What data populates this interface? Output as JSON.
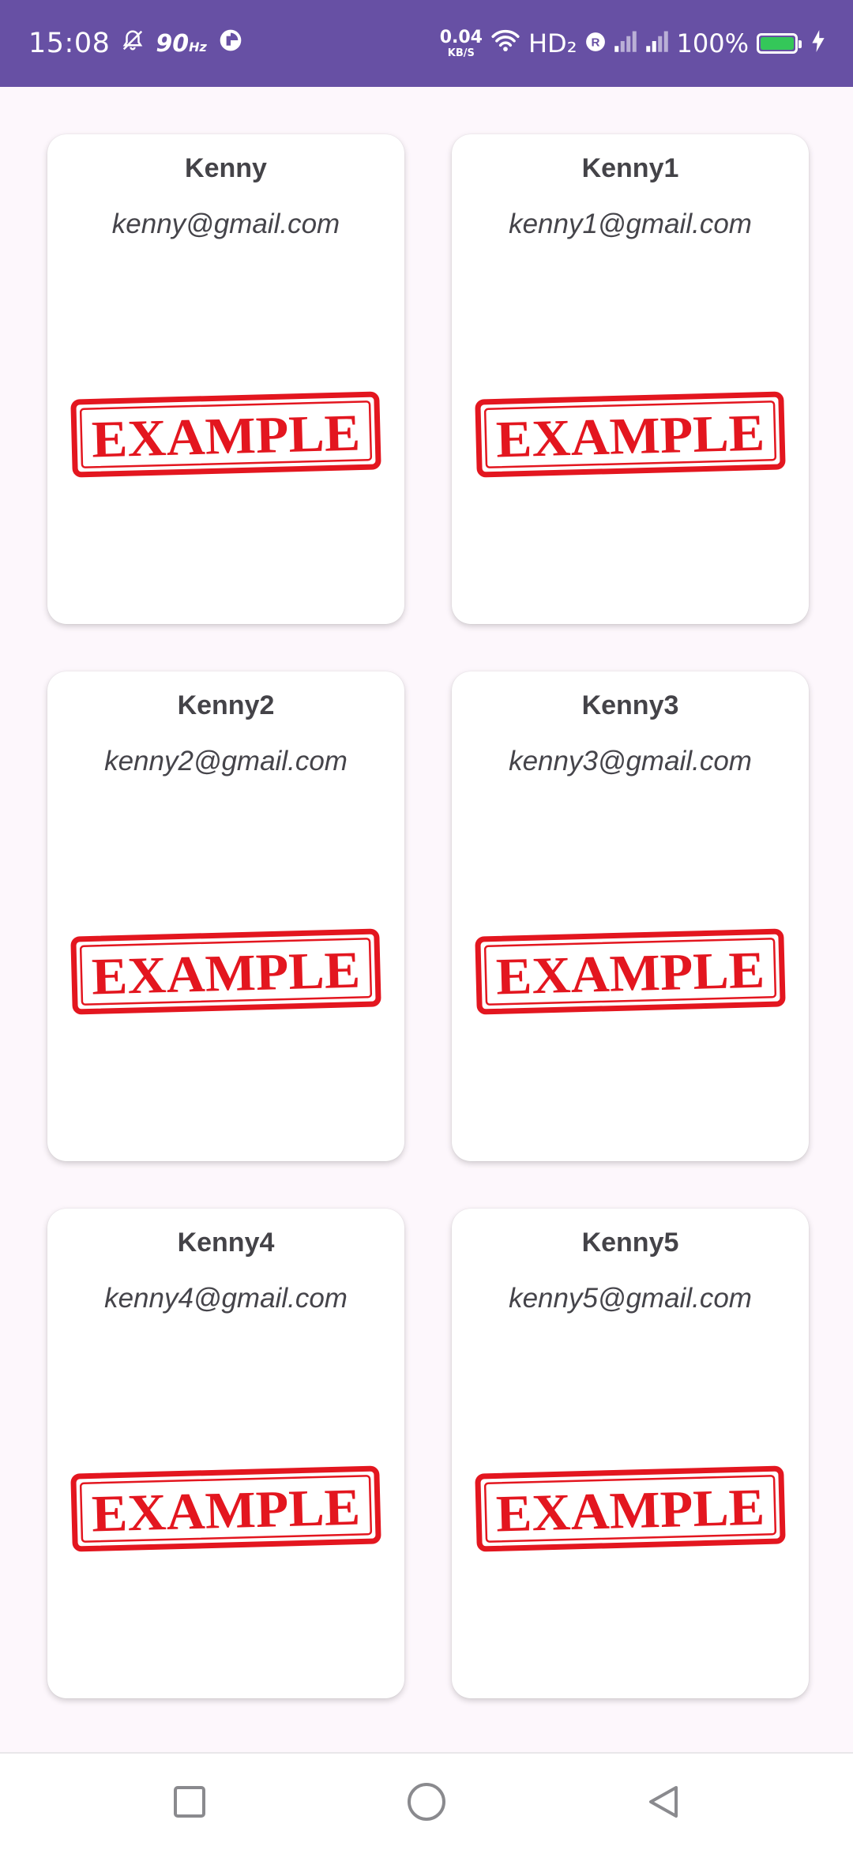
{
  "status_bar": {
    "time": "15:08",
    "refresh_rate": "90",
    "refresh_unit": "Hz",
    "net_speed_value": "0.04",
    "net_speed_unit": "KB/S",
    "network_label": "HD₂",
    "battery_percent": "100%",
    "background_color": "#6750a4",
    "icons": [
      "mute-icon",
      "data-saver-icon",
      "wifi-icon",
      "roaming-icon",
      "signal-icon",
      "battery-icon",
      "charging-icon"
    ]
  },
  "cards": [
    {
      "name": "Kenny",
      "email": "kenny@gmail.com",
      "image_text": "EXAMPLE"
    },
    {
      "name": "Kenny1",
      "email": "kenny1@gmail.com",
      "image_text": "EXAMPLE"
    },
    {
      "name": "Kenny2",
      "email": "kenny2@gmail.com",
      "image_text": "EXAMPLE"
    },
    {
      "name": "Kenny3",
      "email": "kenny3@gmail.com",
      "image_text": "EXAMPLE"
    },
    {
      "name": "Kenny4",
      "email": "kenny4@gmail.com",
      "image_text": "EXAMPLE"
    },
    {
      "name": "Kenny5",
      "email": "kenny5@gmail.com",
      "image_text": "EXAMPLE"
    }
  ],
  "colors": {
    "stamp_red": "#e3161f",
    "card_background": "#ffffff",
    "page_background": "#fdf7fc"
  },
  "nav_bar": {
    "icons": [
      "recents-square-icon",
      "home-circle-icon",
      "back-triangle-icon"
    ]
  }
}
